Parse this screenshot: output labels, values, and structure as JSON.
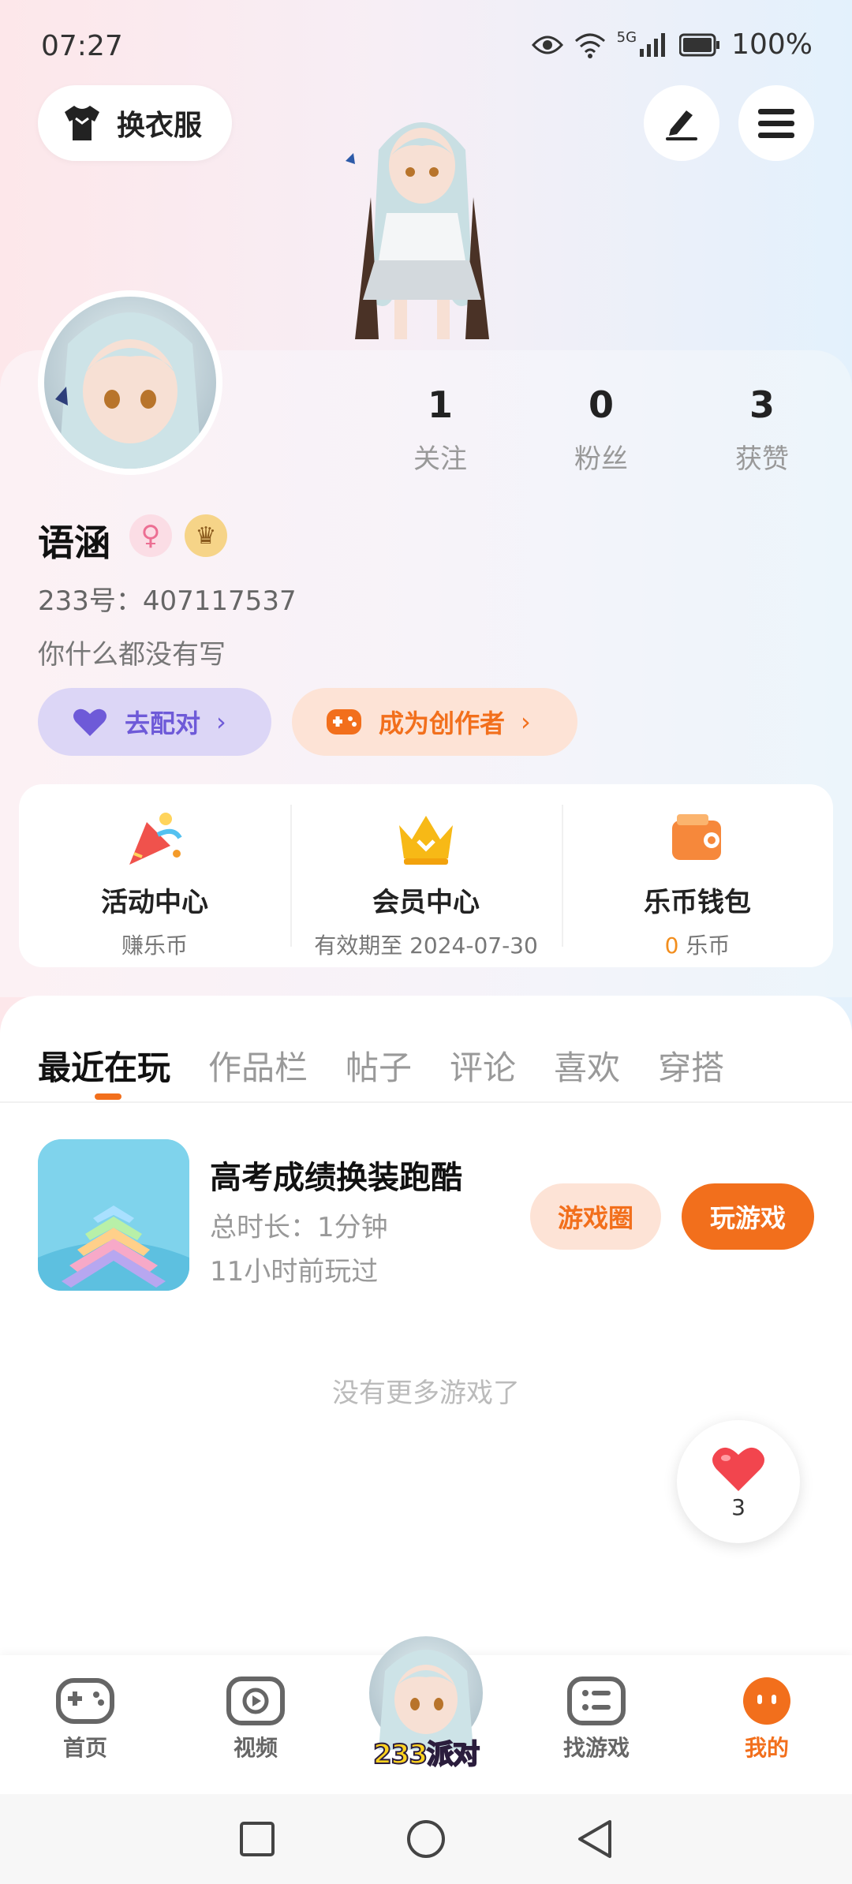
{
  "status_bar": {
    "time": "07:27",
    "network": "5G",
    "battery": "100%"
  },
  "header": {
    "outfit_label": "换衣服"
  },
  "profile": {
    "stats": [
      {
        "value": "1",
        "label": "关注"
      },
      {
        "value": "0",
        "label": "粉丝"
      },
      {
        "value": "3",
        "label": "获赞"
      }
    ],
    "username": "语涵",
    "id_text": "233号：407117537",
    "bio": "你什么都没有写",
    "match_label": "去配对",
    "creator_label": "成为创作者"
  },
  "quick_links": [
    {
      "title": "活动中心",
      "sub": "赚乐币"
    },
    {
      "title": "会员中心",
      "sub": "有效期至 2024-07-30"
    },
    {
      "title": "乐币钱包",
      "sub_value": "0",
      "sub_unit": " 乐币"
    }
  ],
  "tabs": [
    "最近在玩",
    "作品栏",
    "帖子",
    "评论",
    "喜欢",
    "穿搭"
  ],
  "game": {
    "title": "高考成绩换装跑酷",
    "duration": "总时长：1分钟",
    "last_played": "11小时前玩过",
    "circle_label": "游戏圈",
    "play_label": "玩游戏"
  },
  "no_more_text": "没有更多游戏了",
  "like_count": "3",
  "bottom_nav": {
    "home": "首页",
    "video": "视频",
    "center": "233派对",
    "find": "找游戏",
    "mine": "我的"
  },
  "colors": {
    "accent": "#f26f1c",
    "purple": "#6e5ad8"
  }
}
